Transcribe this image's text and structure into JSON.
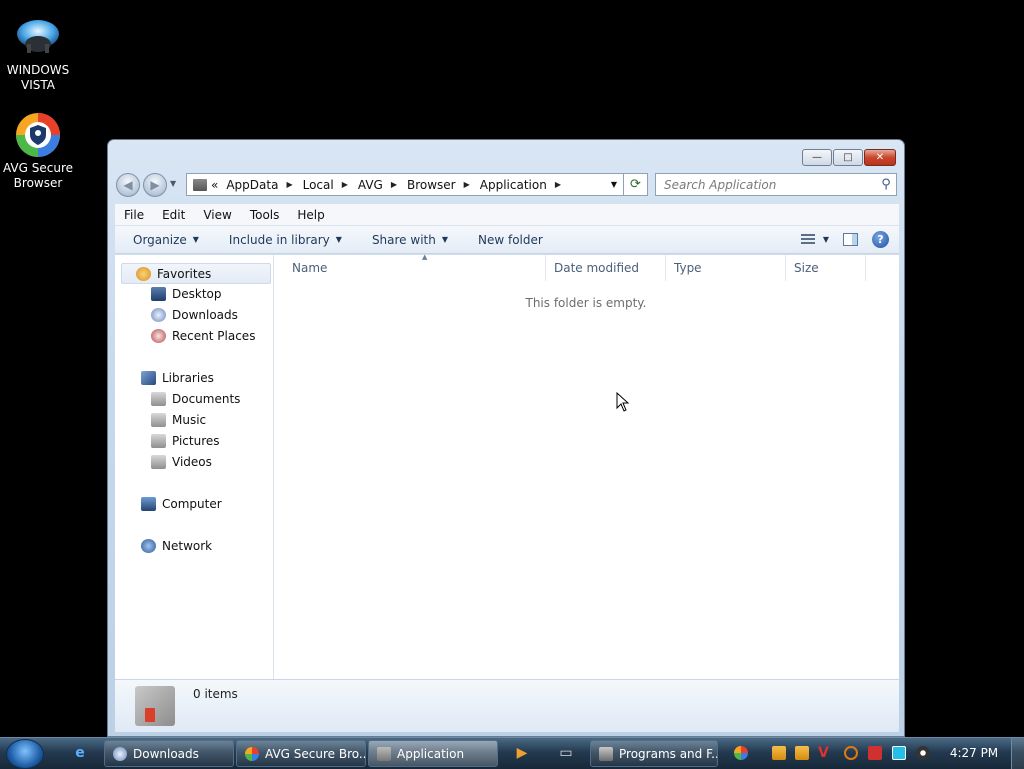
{
  "desktop": {
    "icons": [
      {
        "label_line1": "WINDOWS",
        "label_line2": "VISTA",
        "icon": "vista-disc-icon"
      },
      {
        "label_line1": "AVG Secure",
        "label_line2": "Browser",
        "icon": "avg-browser-icon"
      }
    ]
  },
  "window": {
    "caption_buttons": {
      "minimize": "—",
      "maximize": "□",
      "close": "✕"
    },
    "address": {
      "overflow": "«",
      "crumbs": [
        "AppData",
        "Local",
        "AVG",
        "Browser",
        "Application"
      ]
    },
    "search": {
      "placeholder": "Search Application"
    },
    "menu": [
      "File",
      "Edit",
      "View",
      "Tools",
      "Help"
    ],
    "commands": {
      "organize": "Organize",
      "include_in_library": "Include in library",
      "share_with": "Share with",
      "new_folder": "New folder"
    },
    "nav": {
      "favorites": "Favorites",
      "desktop": "Desktop",
      "downloads": "Downloads",
      "recent_places": "Recent Places",
      "libraries": "Libraries",
      "documents": "Documents",
      "music": "Music",
      "pictures": "Pictures",
      "videos": "Videos",
      "computer": "Computer",
      "network": "Network"
    },
    "columns": [
      "Name",
      "Date modified",
      "Type",
      "Size"
    ],
    "empty_message": "This folder is empty.",
    "details": {
      "count": "0 items"
    }
  },
  "taskbar": {
    "buttons": [
      {
        "label": "Downloads"
      },
      {
        "label": "AVG Secure Bro..."
      },
      {
        "label": "Application"
      },
      {
        "label": "Programs and F..."
      }
    ],
    "clock": "4:27 PM"
  },
  "colors": {
    "accent": "#1e395b",
    "desktop": "#000000",
    "close": "#c9462c"
  }
}
